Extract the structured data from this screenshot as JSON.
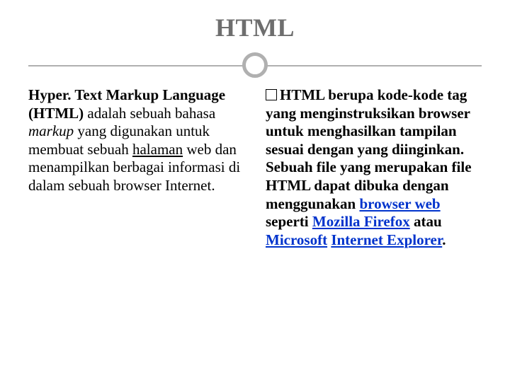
{
  "title": "HTML",
  "left": {
    "lead": "Hyper. Text Markup Language (HTML)",
    "rest1": " adalah sebuah bahasa ",
    "italic": "markup",
    "rest2": " yang digunakan untuk membuat sebuah ",
    "halaman": "halaman",
    "rest3": " web dan menampilkan berbagai informasi di dalam sebuah browser Internet."
  },
  "right": {
    "text1": "HTML berupa kode-kode tag yang menginstruksikan browser untuk menghasilkan tampilan sesuai dengan yang diinginkan. Sebuah file yang merupakan file HTML dapat dibuka dengan menggunakan ",
    "link1": "browser web",
    "text2": " seperti ",
    "link2": "Mozilla Firefox",
    "text3": " atau ",
    "link3a": "Microsoft",
    "space": " ",
    "link3b": "Internet Explorer",
    "text4": "."
  }
}
